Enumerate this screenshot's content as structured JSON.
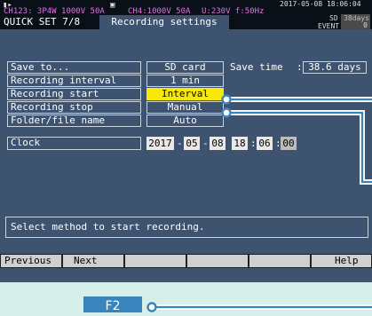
{
  "status_bar": {
    "channel_info": "CH123: 3P4W 1000V 50A",
    "channel4_info": "CH4:1000V 50A",
    "voltage_freq": "U:230V f:50Hz",
    "datetime": "2017-05-08 18:06:04",
    "sd_label": "SD",
    "sd_days": "38days",
    "event_label": "EVENT",
    "event_count": "0"
  },
  "header": {
    "quick_set": "QUICK SET 7/8",
    "tab_title": "Recording settings"
  },
  "settings": [
    {
      "label": "Save to...",
      "value": "SD card"
    },
    {
      "label": "Recording interval",
      "value": "1 min"
    },
    {
      "label": "Recording start",
      "value": "Interval"
    },
    {
      "label": "Recording stop",
      "value": "Manual"
    },
    {
      "label": "Folder/file name",
      "value": "Auto"
    }
  ],
  "save_time": {
    "label": "Save time",
    "sep": ":",
    "value": "38.6 days"
  },
  "clock": {
    "label": "Clock",
    "year": "2017",
    "month": "05",
    "day": "08",
    "hour": "18",
    "minute": "06",
    "second": "00",
    "date_sep": "-",
    "time_sep": ":"
  },
  "message": "Select method to start recording.",
  "function_keys": [
    "Previous",
    "Next",
    "",
    "",
    "",
    "Help"
  ],
  "bottom_button": "F2",
  "colors": {
    "highlight": "#f8e808",
    "screen_bg": "#3d5370",
    "callout": "#3a84be"
  }
}
